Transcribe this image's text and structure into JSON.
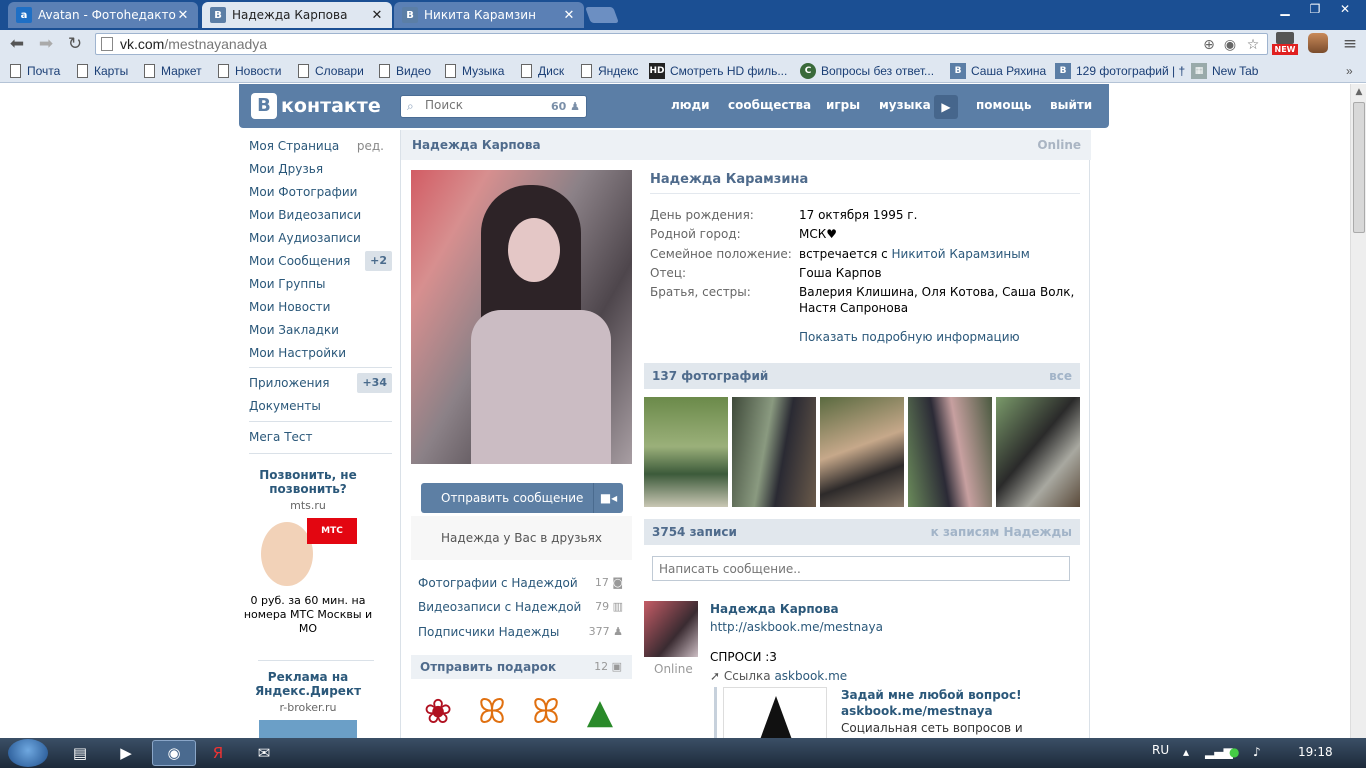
{
  "browser": {
    "tabs": [
      {
        "title": "Avatan - Фотоhедактор!",
        "icon": "avatan-favicon",
        "active": false
      },
      {
        "title": "Надежда Карпова",
        "icon": "vk-favicon",
        "active": true
      },
      {
        "title": "Никита Карамзин",
        "icon": "vk-favicon",
        "active": false
      }
    ],
    "url_host": "vk.com",
    "url_path": "/mestnayanadya",
    "bookmarks": [
      "Почта",
      "Карты",
      "Маркет",
      "Новости",
      "Словари",
      "Видео",
      "Музыка",
      "Диск",
      "Яндекс",
      "Смотреть HD филь...",
      "Вопросы без ответ...",
      "Саша Ряхина",
      "129 фотографий | †",
      "New Tab"
    ],
    "ext_badge": "NEW"
  },
  "vk": {
    "logo_text": "контакте",
    "search_placeholder": "Поиск",
    "search_count": "60",
    "nav": [
      "люди",
      "сообщества",
      "игры",
      "музыка",
      "помощь",
      "выйти"
    ],
    "menu": [
      {
        "label": "Моя Страница",
        "extra": "ред."
      },
      {
        "label": "Мои Друзья"
      },
      {
        "label": "Мои Фотографии"
      },
      {
        "label": "Мои Видеозаписи"
      },
      {
        "label": "Мои Аудиозаписи"
      },
      {
        "label": "Мои Сообщения",
        "badge": "+2"
      },
      {
        "label": "Мои Группы"
      },
      {
        "label": "Мои Новости"
      },
      {
        "label": "Мои Закладки"
      },
      {
        "label": "Мои Настройки"
      },
      {
        "label": "Приложения",
        "badge": "+34"
      },
      {
        "label": "Документы"
      },
      {
        "label": "Мега Тест"
      }
    ],
    "ads": [
      {
        "title": "Позвонить, не позвонить?",
        "domain": "mts.ru",
        "brand": "МТС",
        "text": "0 руб. за 60 мин. на номера МТС Москвы и МО"
      },
      {
        "title": "Реклама на Яндекс.Директ",
        "domain": "r-broker.ru"
      }
    ],
    "page_name": "Надежда Карпова",
    "status": "Online",
    "send_button": "Отправить сообщение",
    "friends_note": "Надежда у Вас в друзьях",
    "side_links": [
      {
        "label": "Фотографии с Надеждой",
        "count": "17"
      },
      {
        "label": "Видеозаписи с Надеждой",
        "count": "79"
      },
      {
        "label": "Подписчики Надежды",
        "count": "377"
      }
    ],
    "gifts": {
      "title": "Отправить подарок",
      "count": "12"
    },
    "profile": {
      "full_name": "Надежда Карамзина",
      "rows": [
        {
          "key": "День рождения:",
          "value": "17 октября 1995 г."
        },
        {
          "key": "Родной город:",
          "value": "МСК♥"
        },
        {
          "key": "Семейное положение:",
          "value": "встречается с ",
          "link": "Никитой Карамзиным"
        },
        {
          "key": "Отец:",
          "value": "Гоша Карпов"
        },
        {
          "key": "Братья, сестры:",
          "value": "Валерия Клишина, Оля Котова, Саша Волк, Настя Сапронова"
        }
      ],
      "more_info": "Показать подробную информацию"
    },
    "photos": {
      "title": "137 фотографий",
      "all": "все"
    },
    "wall": {
      "title": "3754 записи",
      "link": "к записям Надежды",
      "input_placeholder": "Написать сообщение..",
      "post": {
        "author": "Надежда Карпова",
        "link": "http://askbook.me/mestnaya",
        "text": "СПРОСИ :3",
        "source_prefix": "Ссылка",
        "source": "askbook.me",
        "author_status": "Online",
        "card_title": "Задай мне любой вопрос! askbook.me/mestnaya",
        "card_desc": "Социальная сеть вопросов и ответов"
      }
    }
  },
  "taskbar": {
    "lang": "RU",
    "time": "19:18"
  }
}
